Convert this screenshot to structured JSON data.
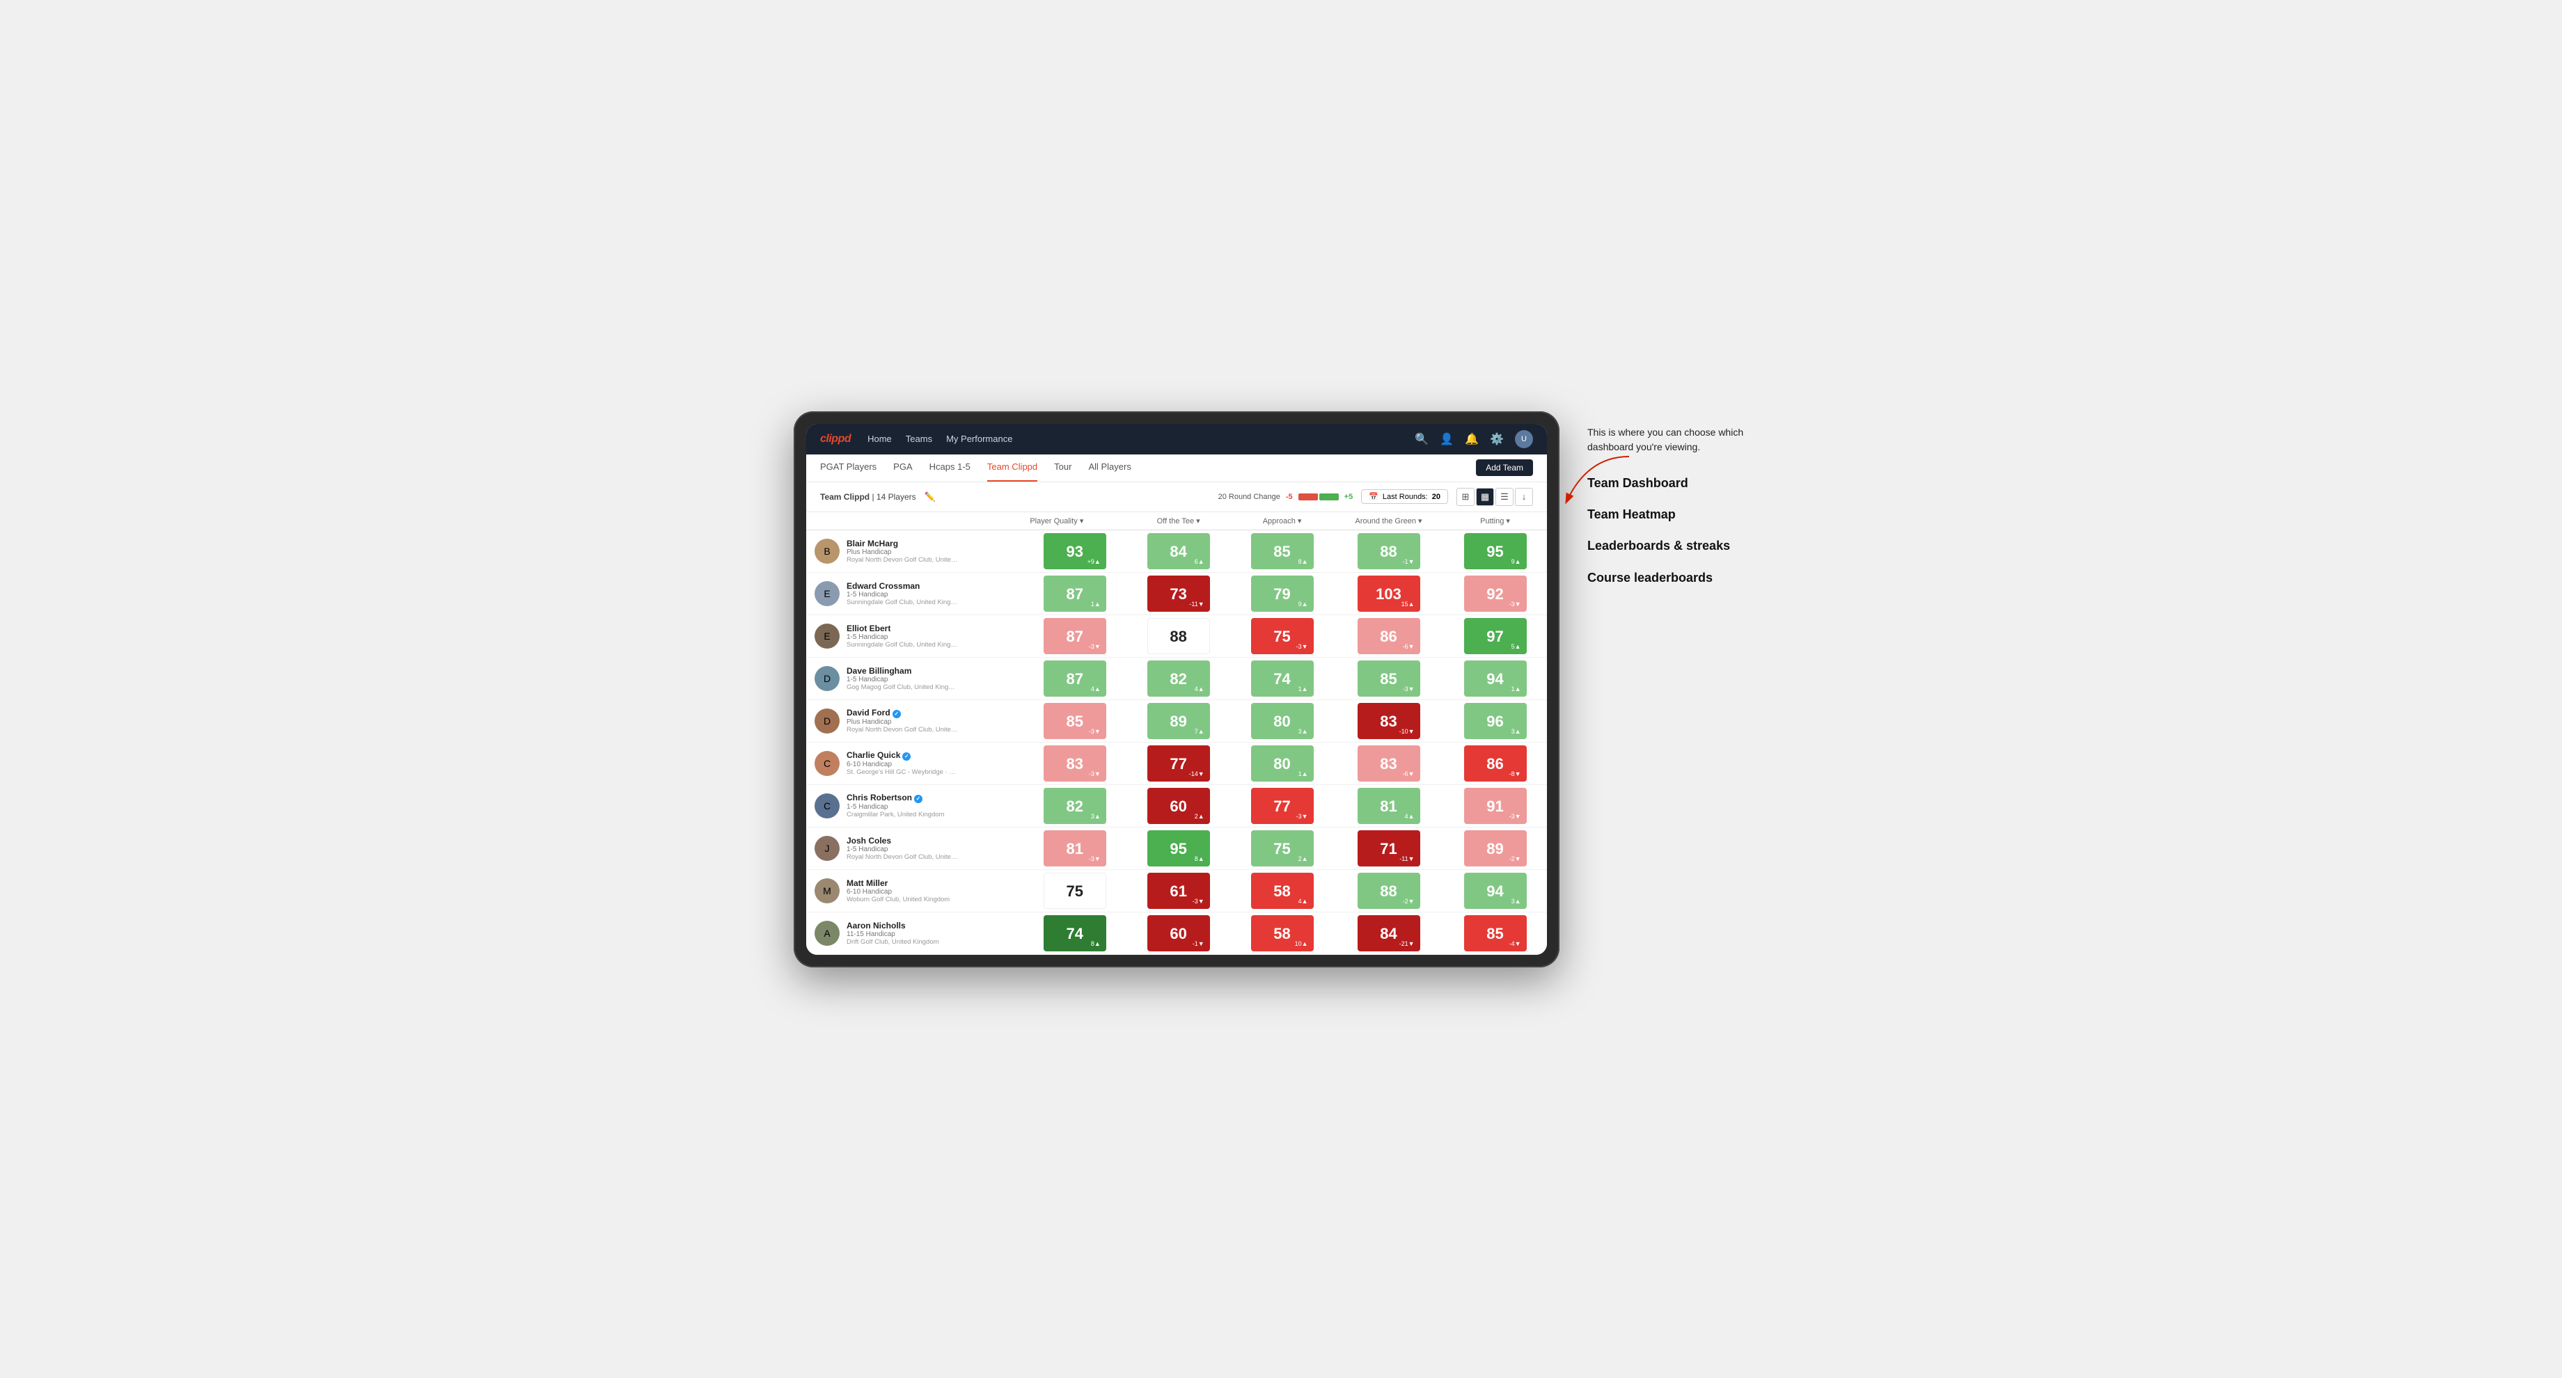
{
  "annotation": {
    "intro": "This is where you can choose which dashboard you're viewing.",
    "items": [
      "Team Dashboard",
      "Team Heatmap",
      "Leaderboards & streaks",
      "Course leaderboards"
    ]
  },
  "nav": {
    "logo": "clippd",
    "links": [
      "Home",
      "Teams",
      "My Performance"
    ],
    "icons": [
      "search",
      "person",
      "bell",
      "settings"
    ]
  },
  "sub_nav": {
    "links": [
      "PGAT Players",
      "PGA",
      "Hcaps 1-5",
      "Team Clippd",
      "Tour",
      "All Players"
    ],
    "active": "Team Clippd",
    "add_team_label": "Add Team"
  },
  "team_header": {
    "team_name": "Team Clippd",
    "player_count": "14 Players",
    "round_change_label": "20 Round Change",
    "round_change_minus": "-5",
    "round_change_plus": "+5",
    "last_rounds_label": "Last Rounds:",
    "last_rounds_value": "20"
  },
  "table": {
    "columns": [
      "Player Quality ▾",
      "Off the Tee ▾",
      "Approach ▾",
      "Around the Green ▾",
      "Putting ▾"
    ],
    "players": [
      {
        "name": "Blair McHarg",
        "handicap": "Plus Handicap",
        "club": "Royal North Devon Golf Club, United Kingdom",
        "avatar_color": "#b8956a",
        "scores": [
          {
            "value": 93,
            "change": "+9",
            "direction": "up",
            "color": "medium-green"
          },
          {
            "value": 84,
            "change": "6",
            "direction": "up",
            "color": "light-green"
          },
          {
            "value": 85,
            "change": "8",
            "direction": "up",
            "color": "light-green"
          },
          {
            "value": 88,
            "change": "-1",
            "direction": "down",
            "color": "light-green"
          },
          {
            "value": 95,
            "change": "9",
            "direction": "up",
            "color": "medium-green"
          }
        ]
      },
      {
        "name": "Edward Crossman",
        "handicap": "1-5 Handicap",
        "club": "Sunningdale Golf Club, United Kingdom",
        "avatar_color": "#8a9bb0",
        "scores": [
          {
            "value": 87,
            "change": "1",
            "direction": "up",
            "color": "light-green"
          },
          {
            "value": 73,
            "change": "-11",
            "direction": "down",
            "color": "dark-red"
          },
          {
            "value": 79,
            "change": "9",
            "direction": "up",
            "color": "light-green"
          },
          {
            "value": 103,
            "change": "15",
            "direction": "up",
            "color": "medium-red"
          },
          {
            "value": 92,
            "change": "-3",
            "direction": "down",
            "color": "light-red"
          }
        ]
      },
      {
        "name": "Elliot Ebert",
        "handicap": "1-5 Handicap",
        "club": "Sunningdale Golf Club, United Kingdom",
        "avatar_color": "#7a6855",
        "scores": [
          {
            "value": 87,
            "change": "-3",
            "direction": "down",
            "color": "light-red"
          },
          {
            "value": 88,
            "change": "",
            "direction": "",
            "color": "white"
          },
          {
            "value": 75,
            "change": "-3",
            "direction": "down",
            "color": "medium-red"
          },
          {
            "value": 86,
            "change": "-6",
            "direction": "down",
            "color": "light-red"
          },
          {
            "value": 97,
            "change": "5",
            "direction": "up",
            "color": "medium-green"
          }
        ]
      },
      {
        "name": "Dave Billingham",
        "handicap": "1-5 Handicap",
        "club": "Gog Magog Golf Club, United Kingdom",
        "avatar_color": "#6b8fa0",
        "scores": [
          {
            "value": 87,
            "change": "4",
            "direction": "up",
            "color": "light-green"
          },
          {
            "value": 82,
            "change": "4",
            "direction": "up",
            "color": "light-green"
          },
          {
            "value": 74,
            "change": "1",
            "direction": "up",
            "color": "light-green"
          },
          {
            "value": 85,
            "change": "-3",
            "direction": "down",
            "color": "light-green"
          },
          {
            "value": 94,
            "change": "1",
            "direction": "up",
            "color": "light-green"
          }
        ]
      },
      {
        "name": "David Ford",
        "handicap": "Plus Handicap",
        "club": "Royal North Devon Golf Club, United Kingdom",
        "verified": true,
        "avatar_color": "#a07050",
        "scores": [
          {
            "value": 85,
            "change": "-3",
            "direction": "down",
            "color": "light-red"
          },
          {
            "value": 89,
            "change": "7",
            "direction": "up",
            "color": "light-green"
          },
          {
            "value": 80,
            "change": "3",
            "direction": "up",
            "color": "light-green"
          },
          {
            "value": 83,
            "change": "-10",
            "direction": "down",
            "color": "dark-red"
          },
          {
            "value": 96,
            "change": "3",
            "direction": "up",
            "color": "light-green"
          }
        ]
      },
      {
        "name": "Charlie Quick",
        "handicap": "6-10 Handicap",
        "club": "St. George's Hill GC - Weybridge · Surrey, Uni...",
        "verified": true,
        "avatar_color": "#c08060",
        "scores": [
          {
            "value": 83,
            "change": "-3",
            "direction": "down",
            "color": "light-red"
          },
          {
            "value": 77,
            "change": "-14",
            "direction": "down",
            "color": "dark-red"
          },
          {
            "value": 80,
            "change": "1",
            "direction": "up",
            "color": "light-green"
          },
          {
            "value": 83,
            "change": "-6",
            "direction": "down",
            "color": "light-red"
          },
          {
            "value": 86,
            "change": "-8",
            "direction": "down",
            "color": "medium-red"
          }
        ]
      },
      {
        "name": "Chris Robertson",
        "handicap": "1-5 Handicap",
        "club": "Craigmillar Park, United Kingdom",
        "verified": true,
        "avatar_color": "#5a7090",
        "scores": [
          {
            "value": 82,
            "change": "3",
            "direction": "up",
            "color": "light-green"
          },
          {
            "value": 60,
            "change": "2",
            "direction": "up",
            "color": "dark-red"
          },
          {
            "value": 77,
            "change": "-3",
            "direction": "down",
            "color": "medium-red"
          },
          {
            "value": 81,
            "change": "4",
            "direction": "up",
            "color": "light-green"
          },
          {
            "value": 91,
            "change": "-3",
            "direction": "down",
            "color": "light-red"
          }
        ]
      },
      {
        "name": "Josh Coles",
        "handicap": "1-5 Handicap",
        "club": "Royal North Devon Golf Club, United Kingdom",
        "avatar_color": "#8a7060",
        "scores": [
          {
            "value": 81,
            "change": "-3",
            "direction": "down",
            "color": "light-red"
          },
          {
            "value": 95,
            "change": "8",
            "direction": "up",
            "color": "medium-green"
          },
          {
            "value": 75,
            "change": "2",
            "direction": "up",
            "color": "light-green"
          },
          {
            "value": 71,
            "change": "-11",
            "direction": "down",
            "color": "dark-red"
          },
          {
            "value": 89,
            "change": "-2",
            "direction": "down",
            "color": "light-red"
          }
        ]
      },
      {
        "name": "Matt Miller",
        "handicap": "6-10 Handicap",
        "club": "Woburn Golf Club, United Kingdom",
        "avatar_color": "#9a8870",
        "scores": [
          {
            "value": 75,
            "change": "",
            "direction": "",
            "color": "white"
          },
          {
            "value": 61,
            "change": "-3",
            "direction": "down",
            "color": "dark-red"
          },
          {
            "value": 58,
            "change": "4",
            "direction": "up",
            "color": "medium-red"
          },
          {
            "value": 88,
            "change": "-2",
            "direction": "down",
            "color": "light-green"
          },
          {
            "value": 94,
            "change": "3",
            "direction": "up",
            "color": "light-green"
          }
        ]
      },
      {
        "name": "Aaron Nicholls",
        "handicap": "11-15 Handicap",
        "club": "Drift Golf Club, United Kingdom",
        "avatar_color": "#7a8868",
        "scores": [
          {
            "value": 74,
            "change": "8",
            "direction": "up",
            "color": "dark-green"
          },
          {
            "value": 60,
            "change": "-1",
            "direction": "down",
            "color": "dark-red"
          },
          {
            "value": 58,
            "change": "10",
            "direction": "up",
            "color": "medium-red"
          },
          {
            "value": 84,
            "change": "-21",
            "direction": "down",
            "color": "dark-red"
          },
          {
            "value": 85,
            "change": "-4",
            "direction": "down",
            "color": "medium-red"
          }
        ]
      }
    ]
  }
}
